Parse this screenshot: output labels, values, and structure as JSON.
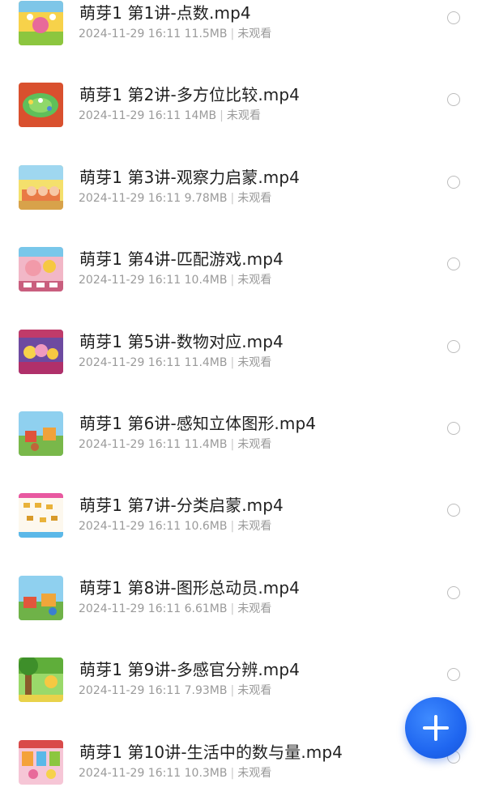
{
  "files": [
    {
      "title": "萌芽1 第1讲-点数.mp4",
      "date": "2024-11-29 16:11",
      "size": "11.5MB",
      "status": "未观看",
      "thumb": "thumb-1"
    },
    {
      "title": "萌芽1 第2讲-多方位比较.mp4",
      "date": "2024-11-29 16:11",
      "size": "14MB",
      "status": "未观看",
      "thumb": "thumb-2"
    },
    {
      "title": "萌芽1 第3讲-观察力启蒙.mp4",
      "date": "2024-11-29 16:11",
      "size": "9.78MB",
      "status": "未观看",
      "thumb": "thumb-3"
    },
    {
      "title": "萌芽1 第4讲-匹配游戏.mp4",
      "date": "2024-11-29 16:11",
      "size": "10.4MB",
      "status": "未观看",
      "thumb": "thumb-4"
    },
    {
      "title": "萌芽1 第5讲-数物对应.mp4",
      "date": "2024-11-29 16:11",
      "size": "11.4MB",
      "status": "未观看",
      "thumb": "thumb-5"
    },
    {
      "title": "萌芽1 第6讲-感知立体图形.mp4",
      "date": "2024-11-29 16:11",
      "size": "11.4MB",
      "status": "未观看",
      "thumb": "thumb-6"
    },
    {
      "title": "萌芽1 第7讲-分类启蒙.mp4",
      "date": "2024-11-29 16:11",
      "size": "10.6MB",
      "status": "未观看",
      "thumb": "thumb-7"
    },
    {
      "title": "萌芽1 第8讲-图形总动员.mp4",
      "date": "2024-11-29 16:11",
      "size": "6.61MB",
      "status": "未观看",
      "thumb": "thumb-8"
    },
    {
      "title": "萌芽1 第9讲-多感官分辨.mp4",
      "date": "2024-11-29 16:11",
      "size": "7.93MB",
      "status": "未观看",
      "thumb": "thumb-9"
    },
    {
      "title": "萌芽1 第10讲-生活中的数与量.mp4",
      "date": "2024-11-29 16:11",
      "size": "10.3MB",
      "status": "未观看",
      "thumb": "thumb-10"
    }
  ],
  "fab": {
    "icon": "plus-icon",
    "color": "#1f66f0"
  },
  "colors": {
    "title": "#1f1f1f",
    "meta": "#9a9a9a",
    "radio": "#bdbdbd"
  }
}
